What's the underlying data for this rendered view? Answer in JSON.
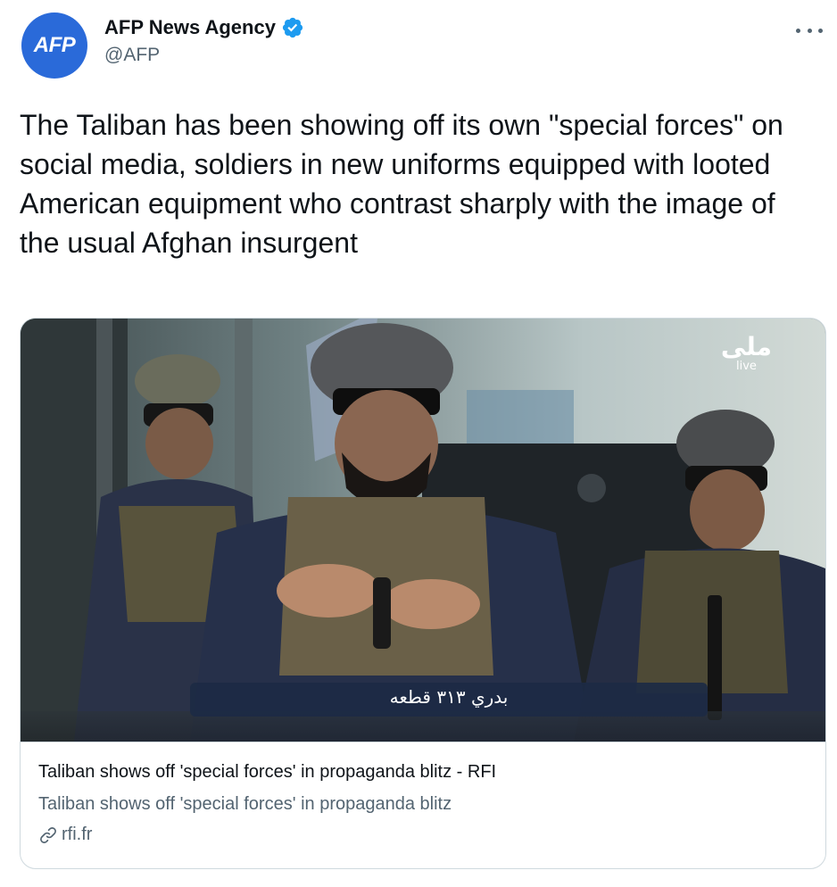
{
  "author": {
    "avatar_text": "AFP",
    "display_name": "AFP News Agency",
    "handle": "@AFP",
    "verified": true
  },
  "tweet": {
    "text": "The Taliban has been showing off its own \"special forces\" on social media, soldiers in new uniforms equipped with looted American equipment who contrast sharply with the image of the usual Afghan insurgent"
  },
  "card": {
    "media_watermark": "ملی",
    "media_watermark_sub": "live",
    "media_caption": "بدري ۳۱۳ قطعه",
    "title": "Taliban shows off 'special forces' in propaganda blitz - RFI",
    "description": "Taliban shows off 'special forces' in propaganda blitz",
    "domain": "rfi.fr"
  },
  "icons": {
    "more": "more-options-icon",
    "verified": "verified-badge-icon",
    "link": "link-icon"
  },
  "colors": {
    "avatar_bg": "#2a6ad9",
    "verified": "#1d9bf0",
    "secondary_text": "#536471",
    "border": "#cfd9de"
  }
}
